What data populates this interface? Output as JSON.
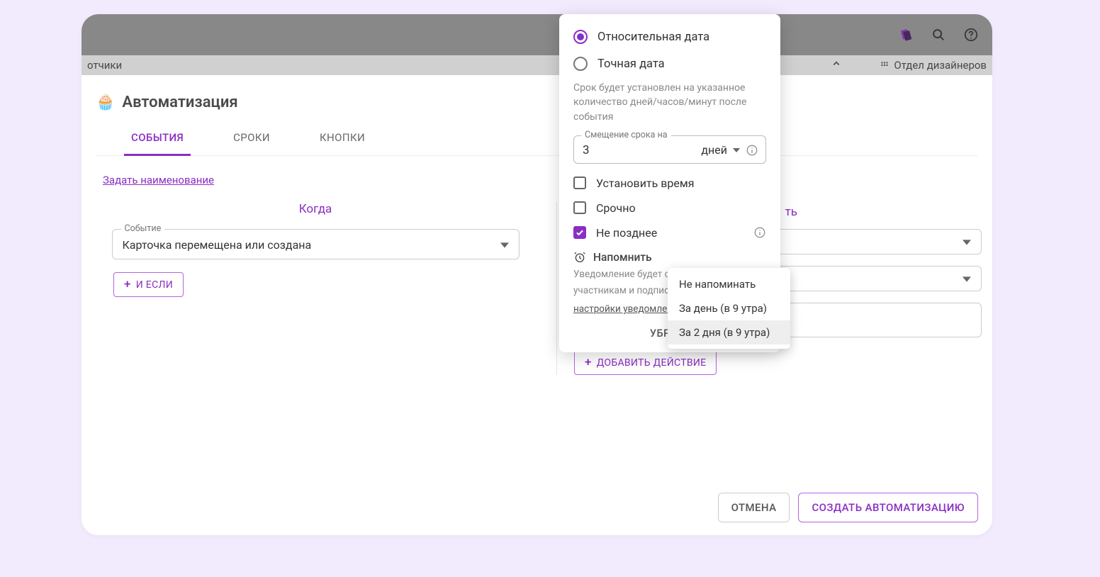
{
  "toolbar": {
    "left_fragment": "отчики",
    "right_column_label": "Отдел дизайнеров"
  },
  "modal": {
    "title": "Автоматизация",
    "tabs": {
      "events": "СОБЫТИЯ",
      "deadlines": "СРОКИ",
      "buttons": "КНОПКИ"
    },
    "set_name": "Задать наименование",
    "when_label": "Когда",
    "do_label_fragment": "ть",
    "event_field_label": "Событие",
    "event_value": "Карточка перемещена или создана",
    "and_if_btn": "И ЕСЛИ",
    "add_action_btn": "ДОБАВИТЬ ДЕЙСТВИЕ",
    "footer": {
      "cancel": "ОТМЕНА",
      "create": "СОЗДАТЬ АВТОМАТИЗАЦИЮ"
    }
  },
  "popover": {
    "radio_relative": "Относительная дата",
    "radio_exact": "Точная дата",
    "desc": "Срок будет установлен на указанное количество дней/часов/минут после события",
    "offset_label": "Смещение срока на",
    "offset_value": "3",
    "offset_unit": "дней",
    "check_set_time": "Установить время",
    "check_urgent": "Срочно",
    "check_no_later": "Не позднее",
    "remind_label": "Напомнить",
    "remind_desc_1": "Уведомление будет отп",
    "remind_desc_2": "участникам и подписчи",
    "remind_link": "настройки уведомлени",
    "remove": "УБРАТЬ"
  },
  "dropdown": {
    "items": [
      "Не напоминать",
      "За день (в 9 утра)",
      "За 2 дня (в 9 утра)"
    ],
    "selected_index": 2
  }
}
